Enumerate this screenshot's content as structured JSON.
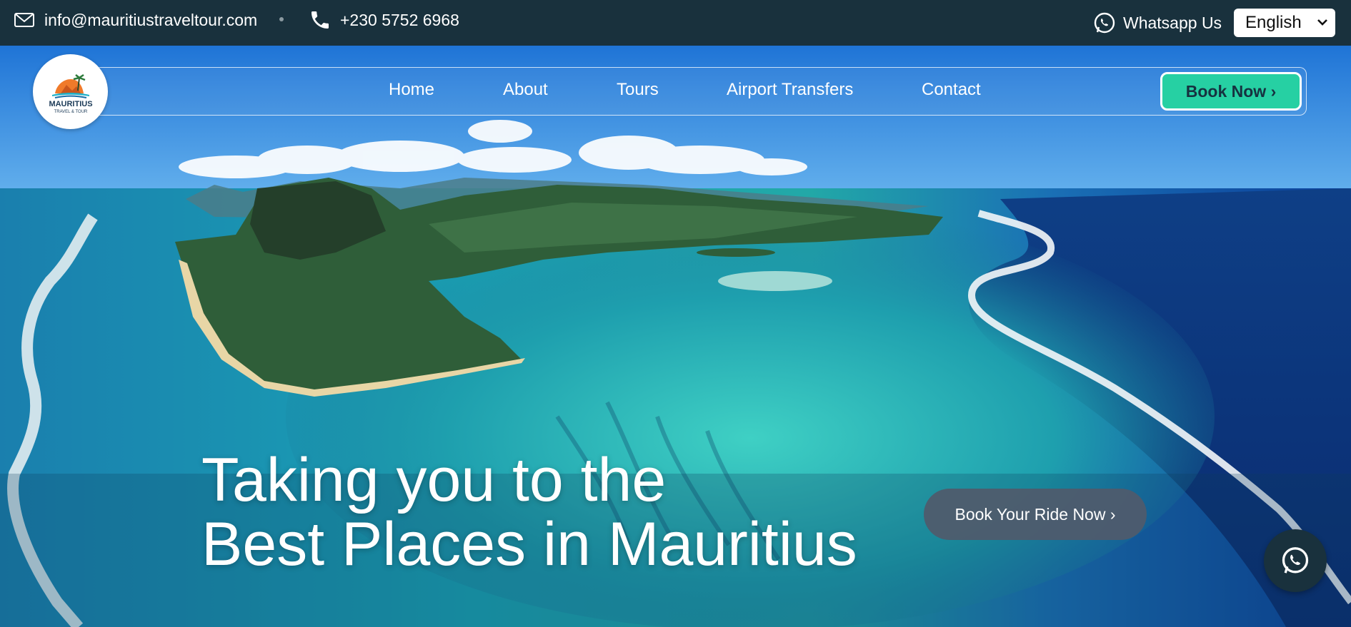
{
  "topbar": {
    "email": "info@mauritiustraveltour.com",
    "phone": "+230 5752 6968",
    "whatsapp_label": "Whatsapp Us",
    "language": "English"
  },
  "logo": {
    "brand": "MAURITIUS",
    "tagline": "TRAVEL & TOUR"
  },
  "nav": {
    "items": [
      {
        "label": "Home"
      },
      {
        "label": "About"
      },
      {
        "label": "Tours"
      },
      {
        "label": "Airport Transfers"
      },
      {
        "label": "Contact"
      }
    ],
    "cta": "Book Now ›"
  },
  "hero": {
    "line1": "Taking you to the",
    "line2": "Best Places in Mauritius",
    "ride_button": "Book Your Ride Now  ›"
  },
  "colors": {
    "topbar_bg": "#19313d",
    "cta_bg": "#26d0a3",
    "ride_btn_bg": "#505a6c"
  },
  "icons": [
    "mail-icon",
    "phone-icon",
    "whatsapp-icon",
    "chevron-down-icon",
    "whatsapp-fab-icon"
  ]
}
